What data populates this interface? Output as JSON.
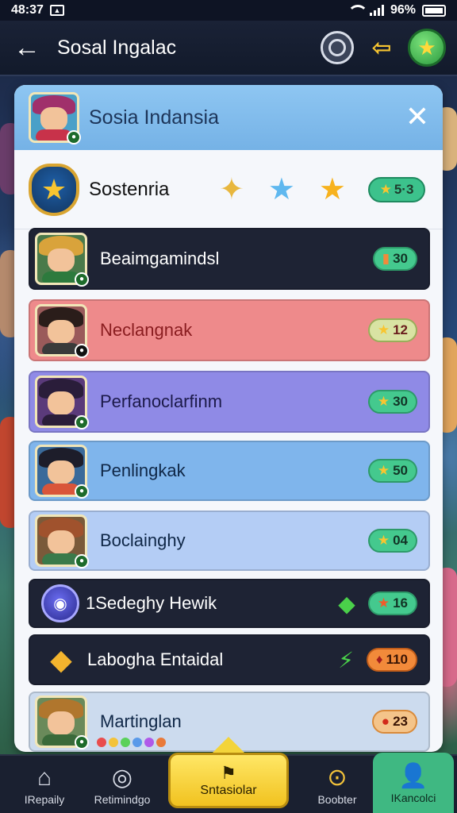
{
  "status_bar": {
    "time": "48:37",
    "battery": "96%"
  },
  "header": {
    "title": "Sosal Ingalac"
  },
  "panel": {
    "title": "Sosia Indansia",
    "subheader": {
      "title": "Sostenria",
      "pill_value": "5·3"
    }
  },
  "rows": [
    {
      "label": "Beaimgamindsl",
      "value": "30",
      "style": "dark"
    },
    {
      "label": "Neclangnak",
      "value": "12",
      "style": "red"
    },
    {
      "label": "Perfanoclarfinm",
      "value": "30",
      "style": "purple"
    },
    {
      "label": "Penlingkak",
      "value": "50",
      "style": "blue"
    },
    {
      "label": "Boclainghy",
      "value": "04",
      "style": "lightblue"
    },
    {
      "label": "1Sedeghy Hewik",
      "value": "16",
      "style": "dark"
    },
    {
      "label": "Labogha Entaidal",
      "value": "110",
      "style": "dark"
    },
    {
      "label": "Martinglan",
      "value": "23",
      "style": "pale"
    }
  ],
  "bottom_nav": {
    "home": "IRepaily",
    "refresh": "Retimindgo",
    "center": "Sntasiolar",
    "boost": "Boobter",
    "account": "IKancolci"
  },
  "colors": {
    "accent_green": "#3fb882",
    "accent_yellow": "#f3d43a",
    "panel_header": "#8ec6f2"
  },
  "icons": [
    "back-arrow-icon",
    "profile-icon",
    "arrow-icon",
    "star-icon",
    "close-icon",
    "shield-star-icon",
    "home-icon",
    "refresh-icon",
    "boost-icon",
    "account-icon"
  ]
}
